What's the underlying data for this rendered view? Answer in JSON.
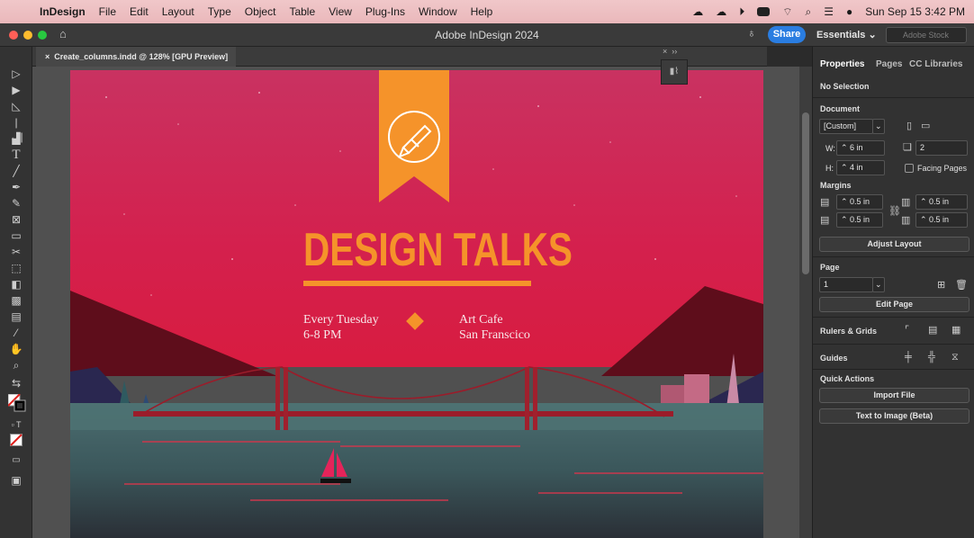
{
  "menubar": {
    "app_name": "InDesign",
    "items": [
      "File",
      "Edit",
      "Layout",
      "Type",
      "Object",
      "Table",
      "View",
      "Plug-Ins",
      "Window",
      "Help"
    ],
    "datetime": "Sun Sep 15  3:42 PM"
  },
  "titlebar": {
    "title": "Adobe InDesign 2024",
    "share_label": "Share",
    "workspace": "Essentials",
    "search_placeholder": "Adobe Stock"
  },
  "document": {
    "tab_label": "Create_columns.indd @ 128% [GPU Preview]"
  },
  "poster": {
    "title": "DESIGN TALKS",
    "line1": "Every Tuesday",
    "line2": "6-8 PM",
    "line3": "Art Cafe",
    "line4": "San Franscico",
    "colors": {
      "sky_top": "#c52f5c",
      "sky_bottom": "#d81f4a",
      "accent": "#f5932a",
      "water": "#3e5a5e"
    }
  },
  "panel": {
    "tabs": [
      "Properties",
      "Pages",
      "CC Libraries"
    ],
    "selection": "No Selection",
    "document_heading": "Document",
    "preset": "[Custom]",
    "width_label": "W:",
    "width": "6 in",
    "height_label": "H:",
    "height": "4 in",
    "pages": "2",
    "facing_pages": "Facing Pages",
    "margins_heading": "Margins",
    "margin_top": "0.5 in",
    "margin_bottom": "0.5 in",
    "margin_left": "0.5 in",
    "margin_right": "0.5 in",
    "adjust_layout": "Adjust Layout",
    "page_heading": "Page",
    "page_number": "1",
    "edit_page": "Edit Page",
    "rulers_grids": "Rulers & Grids",
    "guides": "Guides",
    "quick_actions": "Quick Actions",
    "import_file": "Import File",
    "text_to_image": "Text to Image (Beta)"
  }
}
